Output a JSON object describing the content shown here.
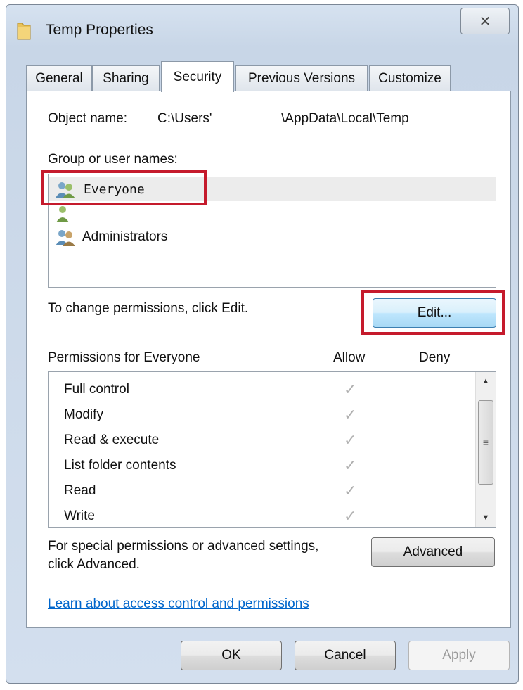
{
  "window": {
    "title": "Temp Properties",
    "close_glyph": "✕"
  },
  "tabs": [
    {
      "label": "General"
    },
    {
      "label": "Sharing"
    },
    {
      "label": "Security",
      "active": true
    },
    {
      "label": "Previous Versions"
    },
    {
      "label": "Customize"
    }
  ],
  "object": {
    "label": "Object name:",
    "path_start": "C:\\Users'",
    "path_end": "\\AppData\\Local\\Temp"
  },
  "group": {
    "label": "Group or user names:",
    "items": [
      {
        "name": "Everyone",
        "icon": "group-users-icon",
        "selected": true
      },
      {
        "name": "",
        "icon": "user-icon"
      },
      {
        "name": "Administrators",
        "icon": "group-users-icon"
      }
    ]
  },
  "change_text": "To change permissions, click Edit.",
  "edit_button": "Edit...",
  "permissions": {
    "label": "Permissions for Everyone",
    "allow_header": "Allow",
    "deny_header": "Deny",
    "rows": [
      {
        "name": "Full control",
        "allow": true,
        "deny": false
      },
      {
        "name": "Modify",
        "allow": true,
        "deny": false
      },
      {
        "name": "Read & execute",
        "allow": true,
        "deny": false
      },
      {
        "name": "List folder contents",
        "allow": true,
        "deny": false
      },
      {
        "name": "Read",
        "allow": true,
        "deny": false
      },
      {
        "name": "Write",
        "allow": true,
        "deny": false
      }
    ],
    "check_glyph": "✓",
    "scroll_thumb_glyph": "≡"
  },
  "advanced": {
    "text_line1": "For special permissions or advanced settings,",
    "text_line2": "click Advanced.",
    "button": "Advanced"
  },
  "link": "Learn about access control and permissions",
  "footer": {
    "ok": "OK",
    "cancel": "Cancel",
    "apply": "Apply"
  },
  "colors": {
    "highlight_box": "#c51a2c",
    "link": "#0066cc",
    "window_frame": "#c8d6e7"
  }
}
